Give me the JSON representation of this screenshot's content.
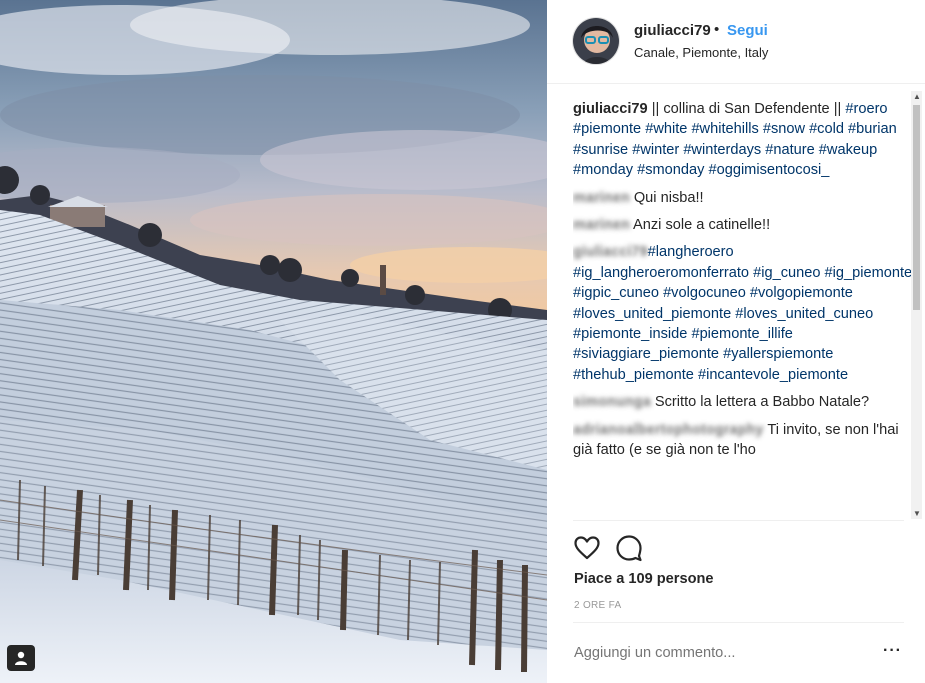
{
  "photo": {
    "alt": "Snow-covered vineyard hills at sunrise",
    "user_tag_icon": "person-icon"
  },
  "header": {
    "username": "giuliacci79",
    "separator": "•",
    "follow_label": "Segui",
    "location": "Canale, Piemonte, Italy"
  },
  "caption": {
    "author": "giuliacci79",
    "text": " || collina di San Defendente || ",
    "hashtags": "#roero #piemonte #white #whitehills #snow #cold #burian #sunrise #winter #winterdays #nature #wakeup #monday #smonday #oggimisentocosi_"
  },
  "comments": [
    {
      "author": "marinen",
      "text": " Qui nisba!!"
    },
    {
      "author": "marinen",
      "text": " Anzi sole a catinelle!!"
    },
    {
      "author": "giuliacci79",
      "text": "",
      "hashtags": "#langheroero #ig_langheroeromonferrato #ig_cuneo #ig_piemonte #igpic_cuneo #volgocuneo #volgopiemonte #loves_united_piemonte #loves_united_cuneo #piemonte_inside #piemonte_illife #siviaggiare_piemonte #yallerspiemonte #thehub_piemonte #incantevole_piemonte"
    },
    {
      "author": "simonunga",
      "text": " Scritto la lettera a Babbo Natale?"
    },
    {
      "author": "adrianoalbertophotography",
      "text": " Ti invito, se non l'hai già fatto (e se già non te l'ho"
    }
  ],
  "actions": {
    "like_icon": "heart-icon",
    "comment_icon": "comment-icon"
  },
  "likes_text": "Piace a 109 persone",
  "time_text": "2 ORE FA",
  "add_comment_placeholder": "Aggiungi un commento...",
  "more_label": "···",
  "colors": {
    "link_blue": "#3897f0",
    "hashtag": "#003569",
    "text": "#262626",
    "muted": "#999999"
  }
}
